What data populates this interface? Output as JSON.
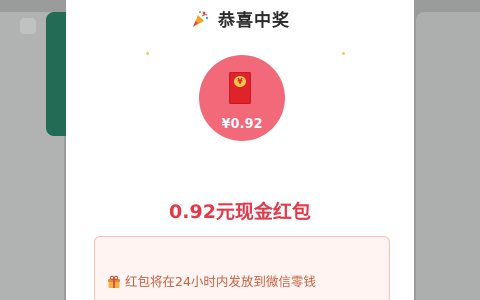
{
  "modal": {
    "title": "恭喜中奖",
    "party_icon": "party-popper-icon",
    "coin_icon": "red-envelope-icon",
    "coin_amount": "¥0.92",
    "cash_label": "0.92元现金红包",
    "notice_icon": "gift-icon",
    "notice_text": "红包将在24小时内发放到微信零钱"
  },
  "colors": {
    "accent": "#e5394a",
    "coin": "#f2697a",
    "envelope": "#e0222a",
    "notice_bg": "#fff4f1",
    "notice_text": "#c56244",
    "overlay_bg": "#9a9c9b",
    "background_green": "#236b55"
  }
}
